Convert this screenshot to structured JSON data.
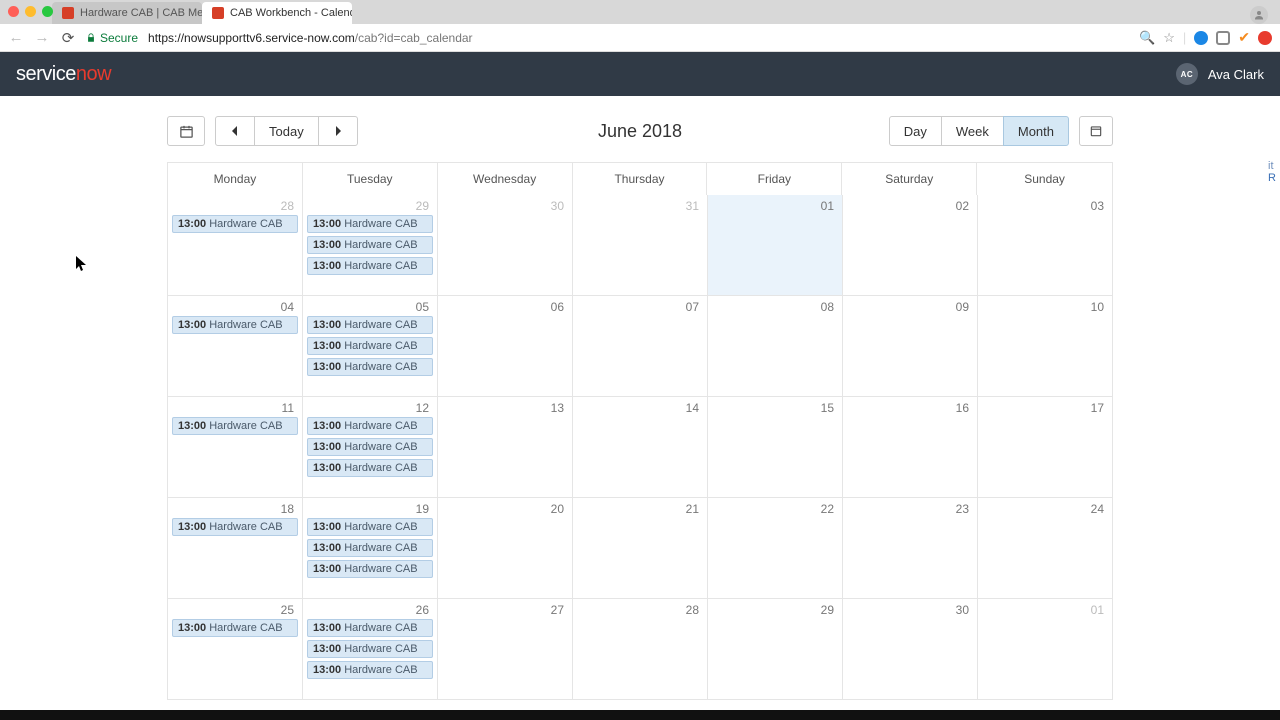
{
  "browser": {
    "tabs": [
      {
        "title": "Hardware CAB | CAB Meeting",
        "active": false
      },
      {
        "title": "CAB Workbench - Calendar - C",
        "active": true
      }
    ],
    "secure_label": "Secure",
    "url_host": "https://nowsupporttv6.service-now.com",
    "url_path": "/cab?id=cab_calendar"
  },
  "header": {
    "logo_a": "service",
    "logo_b": "now",
    "user_initials": "AC",
    "user_name": "Ava Clark"
  },
  "toolbar": {
    "today": "Today",
    "title": "June 2018",
    "views": {
      "day": "Day",
      "week": "Week",
      "month": "Month"
    },
    "active_view": "month"
  },
  "daysOfWeek": [
    "Monday",
    "Tuesday",
    "Wednesday",
    "Thursday",
    "Friday",
    "Saturday",
    "Sunday"
  ],
  "event_time": "13:00",
  "event_label": "Hardware CAB",
  "grid": [
    [
      {
        "num": "28",
        "other": true,
        "events": 1
      },
      {
        "num": "29",
        "other": true,
        "events": 3
      },
      {
        "num": "30",
        "other": true,
        "events": 0
      },
      {
        "num": "31",
        "other": true,
        "events": 0
      },
      {
        "num": "01",
        "today": true,
        "events": 0
      },
      {
        "num": "02",
        "events": 0
      },
      {
        "num": "03",
        "events": 0
      }
    ],
    [
      {
        "num": "04",
        "events": 1
      },
      {
        "num": "05",
        "events": 3
      },
      {
        "num": "06",
        "events": 0
      },
      {
        "num": "07",
        "events": 0
      },
      {
        "num": "08",
        "events": 0
      },
      {
        "num": "09",
        "events": 0
      },
      {
        "num": "10",
        "events": 0
      }
    ],
    [
      {
        "num": "11",
        "events": 1
      },
      {
        "num": "12",
        "events": 3
      },
      {
        "num": "13",
        "events": 0
      },
      {
        "num": "14",
        "events": 0
      },
      {
        "num": "15",
        "events": 0
      },
      {
        "num": "16",
        "events": 0
      },
      {
        "num": "17",
        "events": 0
      }
    ],
    [
      {
        "num": "18",
        "events": 1
      },
      {
        "num": "19",
        "events": 3
      },
      {
        "num": "20",
        "events": 0
      },
      {
        "num": "21",
        "events": 0
      },
      {
        "num": "22",
        "events": 0
      },
      {
        "num": "23",
        "events": 0
      },
      {
        "num": "24",
        "events": 0
      }
    ],
    [
      {
        "num": "25",
        "events": 1
      },
      {
        "num": "26",
        "events": 3
      },
      {
        "num": "27",
        "events": 0
      },
      {
        "num": "28",
        "events": 0
      },
      {
        "num": "29",
        "events": 0
      },
      {
        "num": "30",
        "events": 0
      },
      {
        "num": "01",
        "other": true,
        "events": 0
      }
    ]
  ]
}
